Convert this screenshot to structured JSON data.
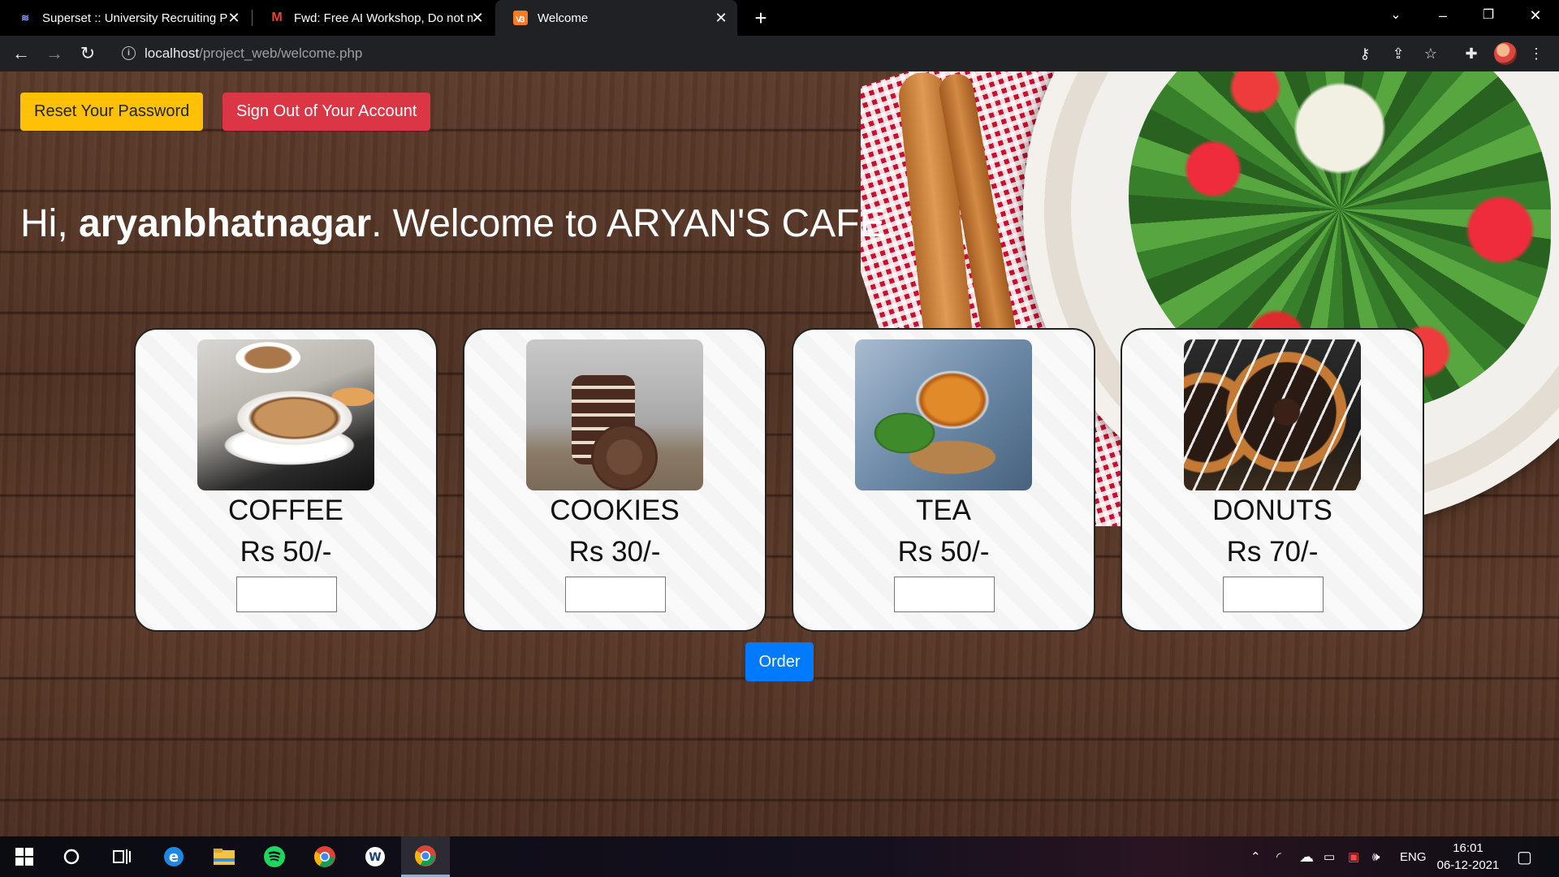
{
  "browser": {
    "tabs": [
      {
        "title": "Superset :: University Recruiting P",
        "icon": "superset-icon",
        "active": false
      },
      {
        "title": "Fwd: Free AI Workshop, Do not m",
        "icon": "gmail-icon",
        "active": false
      },
      {
        "title": "Welcome",
        "icon": "xampp-icon",
        "active": true
      }
    ],
    "new_tab": "+",
    "url_host": "localhost",
    "url_path": "/project_web/welcome.php"
  },
  "page": {
    "reset_label": "Reset Your Password",
    "signout_label": "Sign Out of Your Account",
    "greeting_prefix": "Hi, ",
    "username": "aryanbhatnagar",
    "greeting_suffix": ". Welcome to ARYAN'S CAFE.",
    "items": [
      {
        "name": "COFFEE",
        "price": "Rs 50/-",
        "image": "coffee-image"
      },
      {
        "name": "COOKIES",
        "price": "Rs 30/-",
        "image": "cookies-image"
      },
      {
        "name": "TEA",
        "price": "Rs 50/-",
        "image": "tea-image"
      },
      {
        "name": "DONUTS",
        "price": "Rs 70/-",
        "image": "donuts-image"
      }
    ],
    "order_label": "Order"
  },
  "taskbar": {
    "language": "ENG",
    "time": "16:01",
    "date": "06-12-2021"
  },
  "colors": {
    "reset_button": "#ffc107",
    "signout_button": "#dc3545",
    "order_button": "#007bff"
  }
}
